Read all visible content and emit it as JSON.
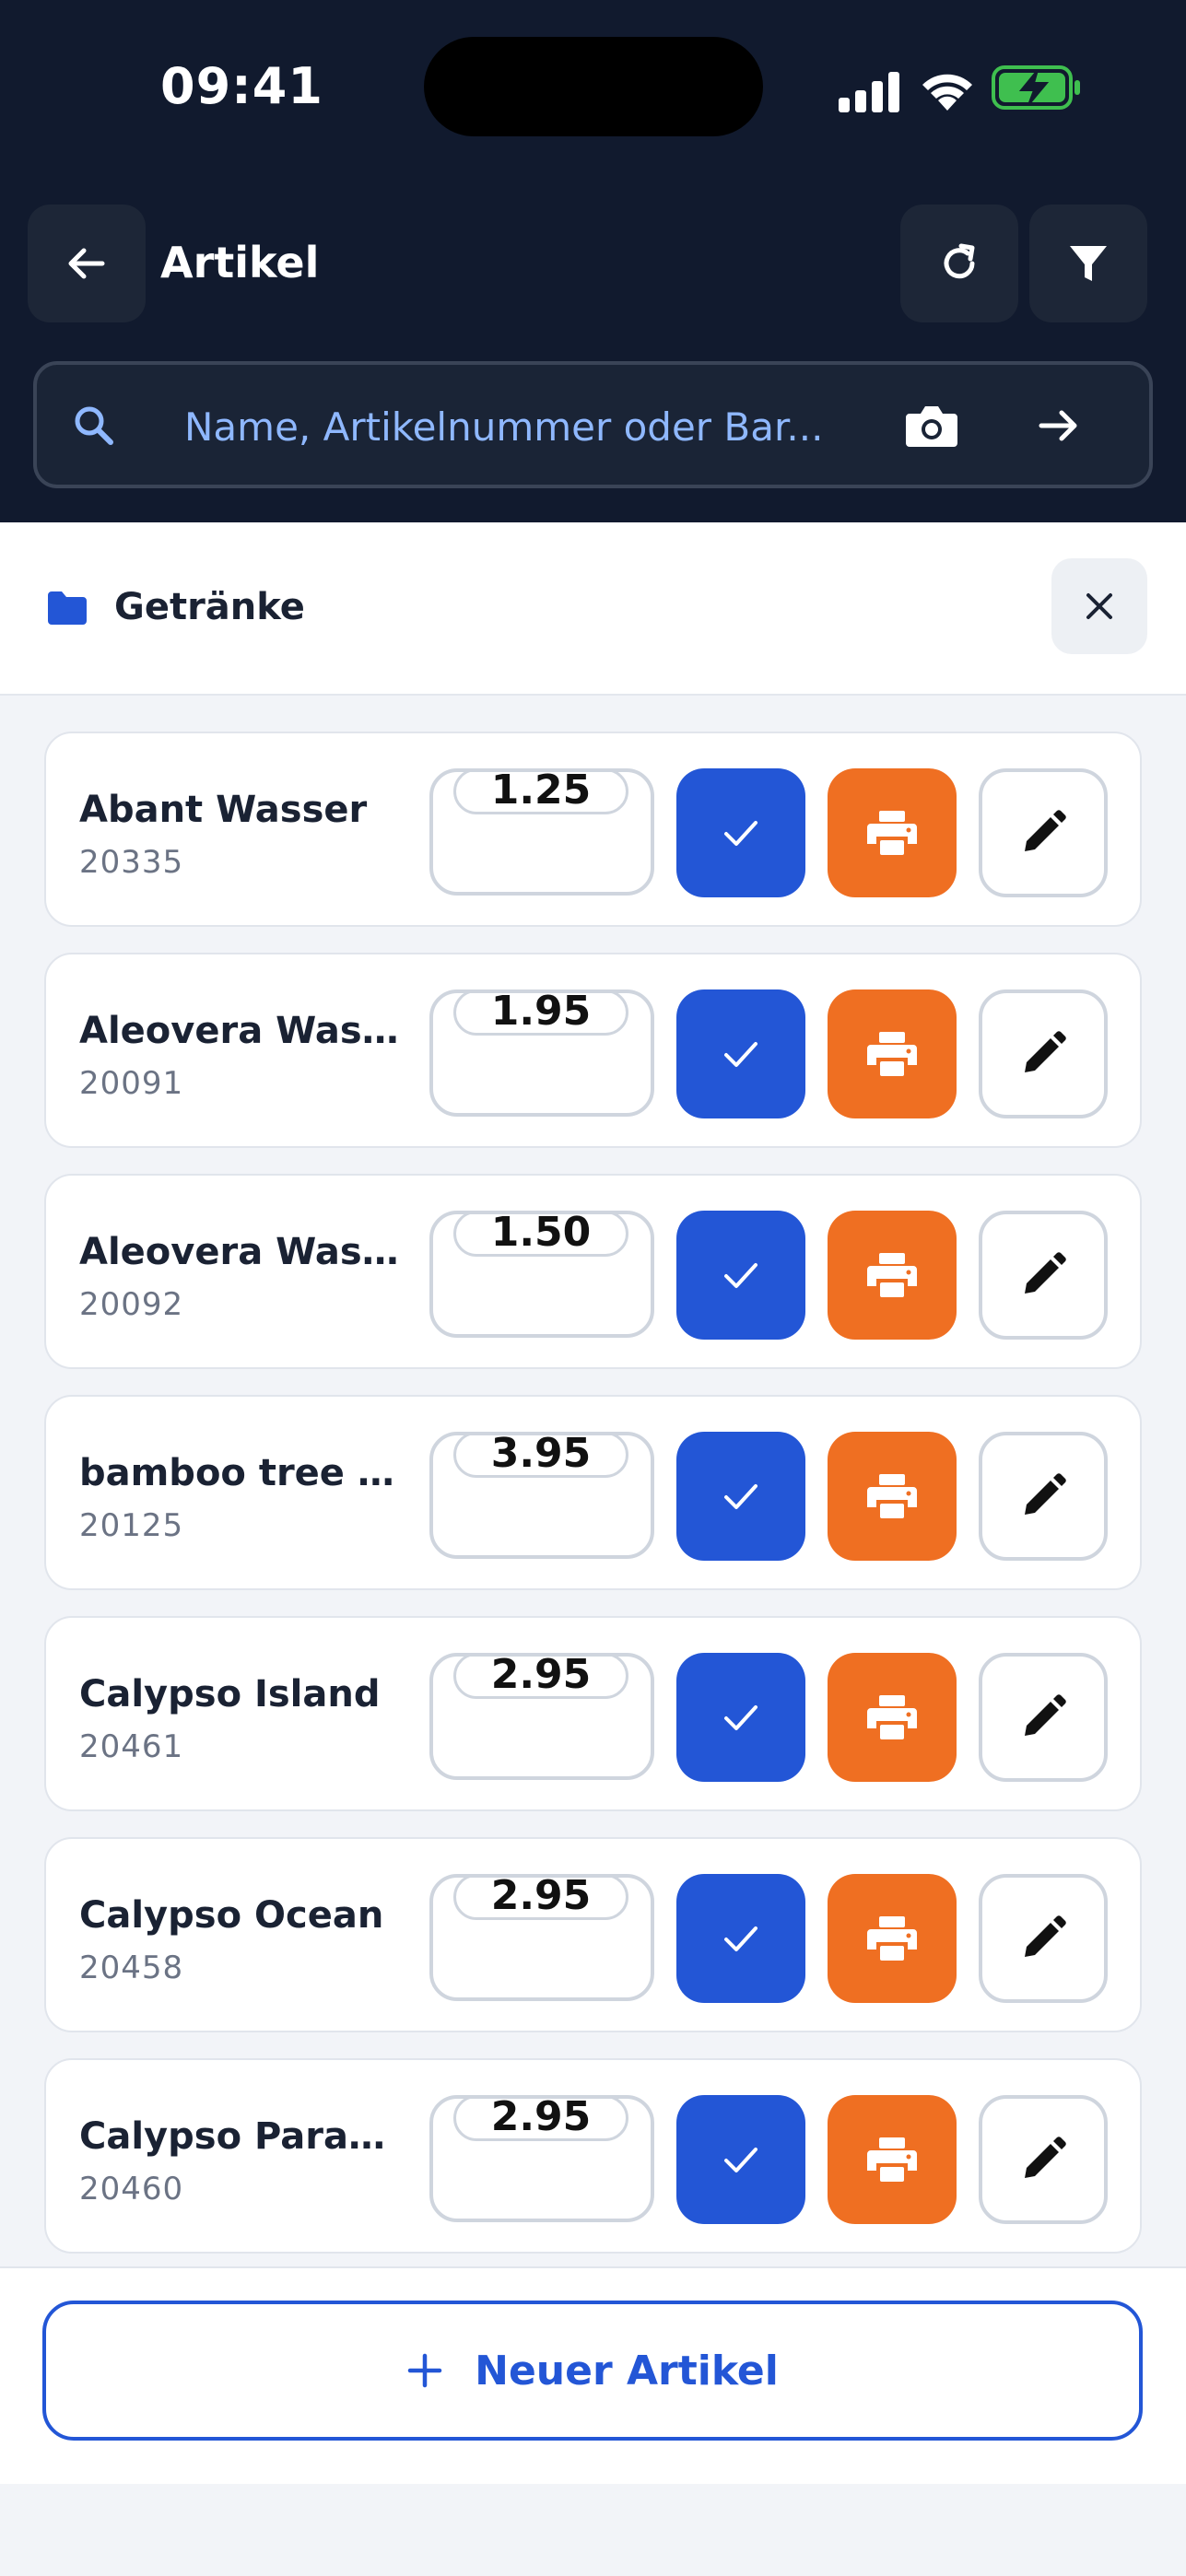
{
  "status_bar": {
    "time": "09:41"
  },
  "header": {
    "title": "Artikel",
    "search_placeholder": "Name, Artikelnummer oder Bar..."
  },
  "category": {
    "label": "Getränke"
  },
  "items": [
    {
      "name": "Abant Wasser",
      "number": "20335",
      "price": "1.25"
    },
    {
      "name": "Aleovera Wasse...",
      "number": "20091",
      "price": "1.95"
    },
    {
      "name": "Aleovera Wasse...",
      "number": "20092",
      "price": "1.50"
    },
    {
      "name": "bamboo tree ko...",
      "number": "20125",
      "price": "3.95"
    },
    {
      "name": "Calypso Island",
      "number": "20461",
      "price": "2.95"
    },
    {
      "name": "Calypso Ocean",
      "number": "20458",
      "price": "2.95"
    },
    {
      "name": "Calypso Paradise",
      "number": "20460",
      "price": "2.95"
    }
  ],
  "footer": {
    "new_item_label": "Neuer Artikel"
  },
  "colors": {
    "header_bg": "#111a2e",
    "accent_blue": "#2356d6",
    "print_orange": "#ef6f22",
    "search_text": "#8fb8ff"
  }
}
